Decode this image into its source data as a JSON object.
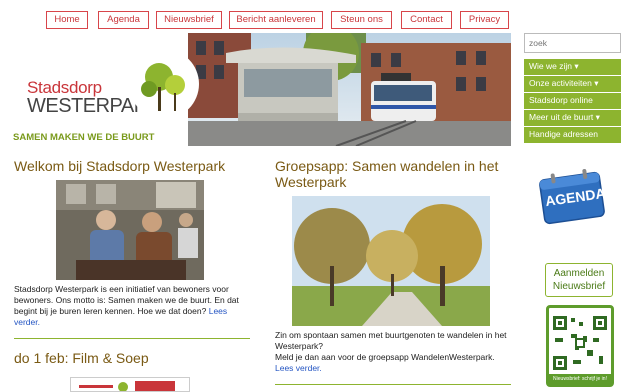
{
  "topnav": [
    "Home",
    "Agenda",
    "Nieuwsbrief",
    "Bericht aanleveren",
    "Steun ons",
    "Contact",
    "Privacy"
  ],
  "logo": {
    "line1": "Stadsdorp",
    "line2": "WESTERPARK"
  },
  "slogan": "SAMEN MAKEN WE DE BUURT",
  "search": {
    "placeholder": "zoek"
  },
  "sidemenu": [
    "Wie we zijn ▾",
    "Onze activiteiten ▾",
    "Stadsdorp online",
    "Meer uit de buurt ▾",
    "Handige adressen"
  ],
  "agenda_label": "AGENDA",
  "nieuwsbrief": {
    "line1": "Aanmelden",
    "line2": "Nieuwsbrief"
  },
  "qr_caption": "Nieuwsbrief: schrijf je in!",
  "article1": {
    "title": "Welkom bij Stadsdorp Westerpark",
    "text": "Stadsdorp Westerpark is een initiatief van bewoners voor bewoners. Ons motto is: Samen maken we de buurt. En dat begint bij je buren leren kennen. Hoe we dat doen?",
    "more": "Lees verder."
  },
  "article2": {
    "title": "Groepsapp: Samen wandelen in het Westerpark",
    "text1": "Zin om spontaan samen met buurtgenoten te wandelen in het Westerpark?",
    "text2": "Meld je dan aan voor de groepsapp WandelenWesterpark.",
    "more": "Lees verder."
  },
  "article3": {
    "title": "do 1 feb: Film & Soep"
  },
  "colors": {
    "nav_red": "#d8454a",
    "green": "#8db42f",
    "title_brown": "#7a5a14",
    "link_blue": "#2455c3"
  }
}
